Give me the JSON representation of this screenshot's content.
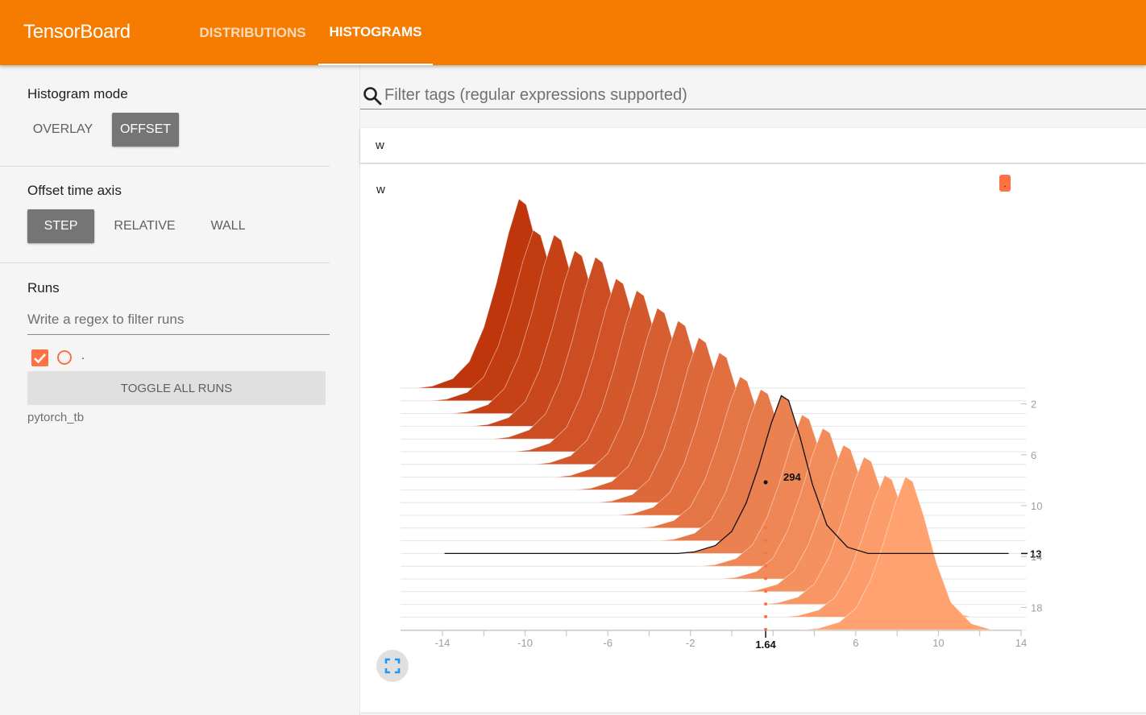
{
  "app": {
    "title": "TensorBoard"
  },
  "tabs": [
    {
      "label": "DISTRIBUTIONS",
      "active": false
    },
    {
      "label": "HISTOGRAMS",
      "active": true
    }
  ],
  "sidebar": {
    "histogram_mode": {
      "title": "Histogram mode",
      "options": [
        "OVERLAY",
        "OFFSET"
      ],
      "selected": "OFFSET"
    },
    "offset_time_axis": {
      "title": "Offset time axis",
      "options": [
        "STEP",
        "RELATIVE",
        "WALL"
      ],
      "selected": "STEP"
    },
    "runs": {
      "title": "Runs",
      "filter_placeholder": "Write a regex to filter runs",
      "items": [
        {
          "name": ".",
          "checked": true,
          "color": "#ff7043"
        }
      ],
      "toggle_label": "TOGGLE ALL RUNS",
      "footnote": "pytorch_tb"
    }
  },
  "main": {
    "filter_placeholder": "Filter tags (regular expressions supported)",
    "group": "w",
    "card": {
      "title": "w",
      "run_badge": "."
    }
  },
  "colors": {
    "accent": "#f57c00",
    "run": "#ff7043",
    "dark_series": "#bf360c",
    "light_series": "#ffa26f"
  },
  "chart_data": {
    "type": "histogram-offset",
    "x_ticks": [
      "-14",
      "-10",
      "-6",
      "-2",
      "6",
      "10",
      "14"
    ],
    "step_ticks": [
      "2",
      "6",
      "10",
      "14",
      "18"
    ],
    "xlim": [
      -14,
      14
    ],
    "step_range": [
      0,
      19
    ],
    "hover": {
      "x_label": "1.64",
      "step_label": "13",
      "value_label": "294"
    },
    "series": [
      {
        "step": 0,
        "center": -10.3,
        "peak": 235
      },
      {
        "step": 1,
        "center": -9.6,
        "peak": 212
      },
      {
        "step": 2,
        "center": -8.6,
        "peak": 222
      },
      {
        "step": 3,
        "center": -7.6,
        "peak": 218
      },
      {
        "step": 4,
        "center": -6.6,
        "peak": 226
      },
      {
        "step": 5,
        "center": -5.6,
        "peak": 215
      },
      {
        "step": 6,
        "center": -4.6,
        "peak": 216
      },
      {
        "step": 7,
        "center": -3.6,
        "peak": 210
      },
      {
        "step": 8,
        "center": -2.6,
        "peak": 210
      },
      {
        "step": 9,
        "center": -1.6,
        "peak": 205
      },
      {
        "step": 10,
        "center": -0.6,
        "peak": 202
      },
      {
        "step": 11,
        "center": 0.4,
        "peak": 188
      },
      {
        "step": 12,
        "center": 1.4,
        "peak": 188
      },
      {
        "step": 13,
        "center": 2.4,
        "peak": 196
      },
      {
        "step": 14,
        "center": 3.4,
        "peak": 188
      },
      {
        "step": 15,
        "center": 4.4,
        "peak": 187
      },
      {
        "step": 16,
        "center": 5.4,
        "peak": 182
      },
      {
        "step": 17,
        "center": 6.4,
        "peak": 183
      },
      {
        "step": 18,
        "center": 7.4,
        "peak": 176
      },
      {
        "step": 19,
        "center": 8.4,
        "peak": 190
      }
    ]
  }
}
